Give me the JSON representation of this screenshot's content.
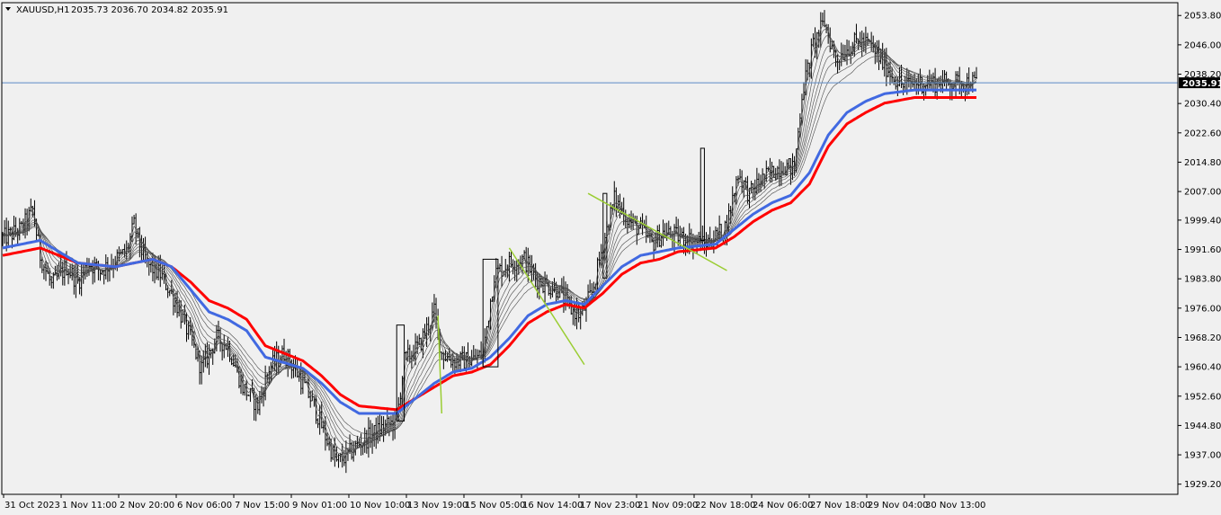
{
  "chart_data": {
    "type": "candlestick",
    "symbol_timeframe": "XAUUSD,H1",
    "ohlc_header": "2035.73 2036.70 2034.82 2035.91",
    "current_price": 2035.91,
    "current_price_label": "2035.91",
    "ylim": [
      1926.5,
      2057.2
    ],
    "price_ticks": [
      "2053.80",
      "2046.00",
      "2038.20",
      "2030.40",
      "2022.60",
      "2014.80",
      "2007.00",
      "1999.40",
      "1991.60",
      "1983.80",
      "1976.00",
      "1968.20",
      "1960.40",
      "1952.60",
      "1944.80",
      "1937.00",
      "1929.20"
    ],
    "time_ticks": [
      "31 Oct 2023",
      "1 Nov 11:00",
      "2 Nov 20:00",
      "6 Nov 06:00",
      "7 Nov 15:00",
      "9 Nov 01:00",
      "10 Nov 10:00",
      "13 Nov 19:00",
      "15 Nov 05:00",
      "16 Nov 14:00",
      "17 Nov 23:00",
      "21 Nov 09:00",
      "22 Nov 18:00",
      "24 Nov 06:00",
      "27 Nov 18:00",
      "29 Nov 04:00",
      "30 Nov 13:00"
    ],
    "bars_count": 520,
    "close_path": [
      [
        0,
        1994.5
      ],
      [
        10,
        1997
      ],
      [
        16,
        2002
      ],
      [
        20,
        1990
      ],
      [
        26,
        1982
      ],
      [
        34,
        1987
      ],
      [
        40,
        1983
      ],
      [
        46,
        1988
      ],
      [
        52,
        1986
      ],
      [
        58,
        1988
      ],
      [
        66,
        1991
      ],
      [
        70,
        1998
      ],
      [
        76,
        1988
      ],
      [
        84,
        1985
      ],
      [
        92,
        1978
      ],
      [
        100,
        1968
      ],
      [
        106,
        1960
      ],
      [
        114,
        1968
      ],
      [
        120,
        1966
      ],
      [
        128,
        1955
      ],
      [
        136,
        1950
      ],
      [
        142,
        1960
      ],
      [
        150,
        1964
      ],
      [
        158,
        1958
      ],
      [
        166,
        1950
      ],
      [
        172,
        1942
      ],
      [
        178,
        1935
      ],
      [
        184,
        1937
      ],
      [
        190,
        1940
      ],
      [
        196,
        1942
      ],
      [
        202,
        1944
      ],
      [
        210,
        1946
      ],
      [
        214,
        1962
      ],
      [
        222,
        1966
      ],
      [
        230,
        1975
      ],
      [
        234,
        1964
      ],
      [
        240,
        1962
      ],
      [
        250,
        1962
      ],
      [
        256,
        1964
      ],
      [
        262,
        1985
      ],
      [
        270,
        1988
      ],
      [
        278,
        1989
      ],
      [
        284,
        1984
      ],
      [
        290,
        1982
      ],
      [
        296,
        1981
      ],
      [
        302,
        1976
      ],
      [
        308,
        1974
      ],
      [
        314,
        1980
      ],
      [
        320,
        1993
      ],
      [
        326,
        2005
      ],
      [
        334,
        1999
      ],
      [
        340,
        1997
      ],
      [
        346,
        1993
      ],
      [
        352,
        1996
      ],
      [
        360,
        1995
      ],
      [
        368,
        1994
      ],
      [
        374,
        1993
      ],
      [
        380,
        1995
      ],
      [
        386,
        1998
      ],
      [
        392,
        2012
      ],
      [
        398,
        2006
      ],
      [
        404,
        2010
      ],
      [
        410,
        2012
      ],
      [
        416,
        2014
      ],
      [
        422,
        2013
      ],
      [
        426,
        2033
      ],
      [
        432,
        2046
      ],
      [
        438,
        2052
      ],
      [
        444,
        2042
      ],
      [
        450,
        2045
      ],
      [
        456,
        2047
      ],
      [
        462,
        2046
      ],
      [
        468,
        2042
      ],
      [
        474,
        2038
      ],
      [
        480,
        2035
      ],
      [
        486,
        2035.91
      ]
    ],
    "moving_averages": [
      {
        "color": "#ff0000",
        "width": 3,
        "values": [
          [
            0,
            1990
          ],
          [
            20,
            1992
          ],
          [
            40,
            1988
          ],
          [
            60,
            1987
          ],
          [
            70,
            1988
          ],
          [
            80,
            1989
          ],
          [
            90,
            1987
          ],
          [
            100,
            1983
          ],
          [
            110,
            1978
          ],
          [
            120,
            1976
          ],
          [
            130,
            1973
          ],
          [
            140,
            1966
          ],
          [
            160,
            1962
          ],
          [
            170,
            1958
          ],
          [
            180,
            1953
          ],
          [
            190,
            1950
          ],
          [
            210,
            1949
          ],
          [
            220,
            1952
          ],
          [
            230,
            1955
          ],
          [
            240,
            1958
          ],
          [
            250,
            1959
          ],
          [
            260,
            1961
          ],
          [
            270,
            1966
          ],
          [
            280,
            1972
          ],
          [
            290,
            1975
          ],
          [
            300,
            1977
          ],
          [
            310,
            1976
          ],
          [
            320,
            1980
          ],
          [
            330,
            1985
          ],
          [
            340,
            1988
          ],
          [
            350,
            1989
          ],
          [
            360,
            1991
          ],
          [
            380,
            1992
          ],
          [
            390,
            1995
          ],
          [
            400,
            1999
          ],
          [
            410,
            2002
          ],
          [
            420,
            2004
          ],
          [
            430,
            2009
          ],
          [
            440,
            2019
          ],
          [
            450,
            2025
          ],
          [
            460,
            2028
          ],
          [
            470,
            2030.5
          ],
          [
            486,
            2032
          ]
        ]
      },
      {
        "color": "#4169e1",
        "width": 3,
        "values": [
          [
            0,
            1992
          ],
          [
            20,
            1994
          ],
          [
            40,
            1988
          ],
          [
            60,
            1987
          ],
          [
            70,
            1988
          ],
          [
            80,
            1989
          ],
          [
            90,
            1987
          ],
          [
            100,
            1981
          ],
          [
            110,
            1975
          ],
          [
            120,
            1973
          ],
          [
            130,
            1970
          ],
          [
            140,
            1963
          ],
          [
            160,
            1960
          ],
          [
            170,
            1956
          ],
          [
            180,
            1951
          ],
          [
            190,
            1948
          ],
          [
            210,
            1948
          ],
          [
            220,
            1952
          ],
          [
            230,
            1956
          ],
          [
            240,
            1959
          ],
          [
            250,
            1960
          ],
          [
            260,
            1963
          ],
          [
            270,
            1968
          ],
          [
            280,
            1974
          ],
          [
            290,
            1977
          ],
          [
            300,
            1978
          ],
          [
            310,
            1977
          ],
          [
            320,
            1982
          ],
          [
            330,
            1987
          ],
          [
            340,
            1990
          ],
          [
            350,
            1991
          ],
          [
            360,
            1992
          ],
          [
            380,
            1993
          ],
          [
            390,
            1997
          ],
          [
            400,
            2001
          ],
          [
            410,
            2004
          ],
          [
            420,
            2006
          ],
          [
            430,
            2012
          ],
          [
            440,
            2022
          ],
          [
            450,
            2028
          ],
          [
            460,
            2031
          ],
          [
            470,
            2033
          ],
          [
            486,
            2034
          ]
        ]
      }
    ],
    "annotations": [
      {
        "kind": "rectangle",
        "x0": 210,
        "x1": 214,
        "y0": 1946,
        "y1": 1971.5
      },
      {
        "kind": "rectangle",
        "x0": 256,
        "x1": 264,
        "y0": 1960.4,
        "y1": 1989
      },
      {
        "kind": "rectangle",
        "x0": 320,
        "x1": 322,
        "y0": 1984,
        "y1": 2006.5
      },
      {
        "kind": "rectangle",
        "x0": 372,
        "x1": 374,
        "y0": 1994,
        "y1": 2018.5
      },
      {
        "kind": "trendline",
        "color": "#9acd32",
        "x0": 232,
        "y0": 1974,
        "x1": 234,
        "y1": 1948
      },
      {
        "kind": "trendline",
        "color": "#9acd32",
        "x0": 270,
        "y0": 1992,
        "x1": 310,
        "y1": 1961
      },
      {
        "kind": "trendline",
        "color": "#9acd32",
        "x0": 312,
        "y0": 2006.5,
        "x1": 386,
        "y1": 1986
      }
    ],
    "colors": {
      "background": "#f0f0f0",
      "axis": "#000000",
      "candles": "#000000",
      "ma_grey": "#4a4a4a",
      "price_line": "#5b8ac7",
      "current_price_bg": "#000000"
    }
  }
}
